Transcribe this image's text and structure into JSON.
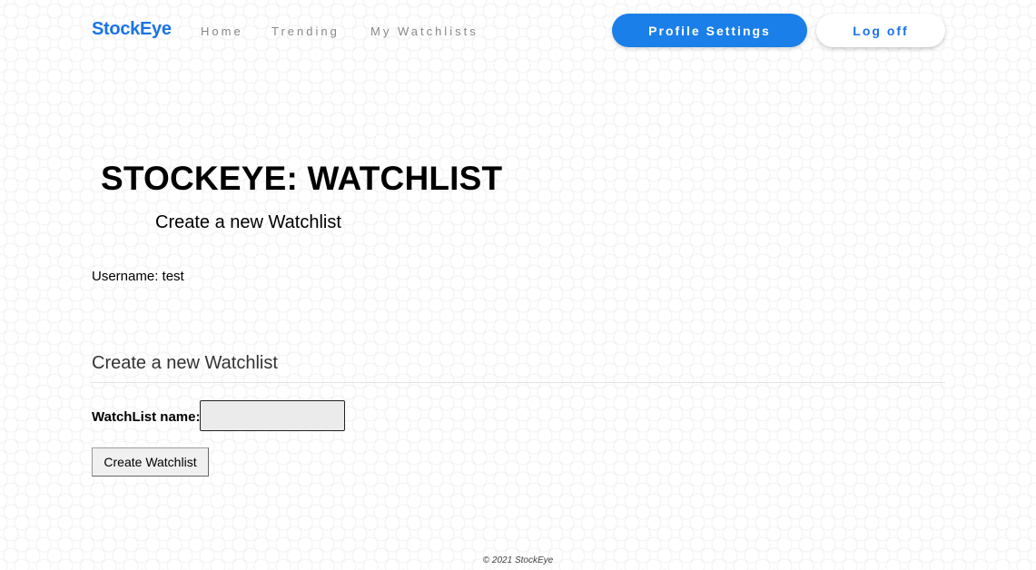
{
  "nav": {
    "brand": "StockEye",
    "links": [
      "Home",
      "Trending",
      "My Watchlists"
    ],
    "profile_button": "Profile Settings",
    "logoff_button": "Log off",
    "brand_color": "#1a73e8"
  },
  "main": {
    "title": "STOCKEYE: WATCHLIST",
    "subtitle": "Create a new Watchlist",
    "username_line": "Username: test",
    "section_heading": "Create a new Watchlist",
    "form": {
      "name_label": "WatchList name:",
      "name_value": "",
      "submit_label": "Create Watchlist"
    }
  },
  "footer": {
    "copyright": "© 2021 StockEye"
  }
}
